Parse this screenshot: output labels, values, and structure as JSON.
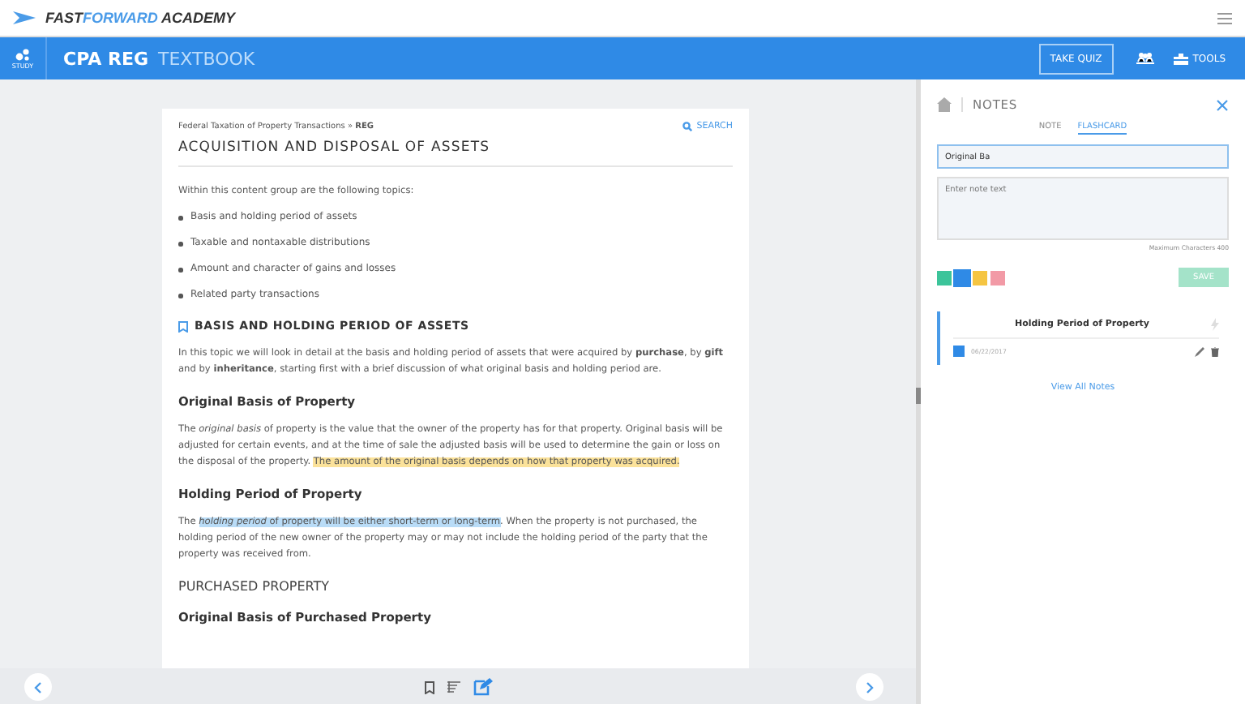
{
  "brand": {
    "name_a": "FAST",
    "name_b": "FORWARD",
    "name_c": " ACADEMY"
  },
  "topbar": {
    "study_label": "STUDY",
    "course": "CPA REG",
    "section": "TEXTBOOK",
    "take_quiz": "TAKE QUIZ",
    "tools": "TOOLS"
  },
  "article": {
    "breadcrumb": "Federal Taxation of Property Transactions » **REG**",
    "search": "SEARCH",
    "title": "ACQUISITION AND DISPOSAL OF ASSETS",
    "blocks": [
      {
        "kind": "para",
        "segments": [
          {
            "text": "Within this content group are the following topics:"
          }
        ]
      },
      {
        "kind": "bullet",
        "segments": [
          {
            "text": "Basis and holding period of assets"
          }
        ]
      },
      {
        "kind": "bullet",
        "segments": [
          {
            "text": "Taxable and nontaxable distributions"
          }
        ]
      },
      {
        "kind": "bullet",
        "segments": [
          {
            "text": "Amount and character of gains and losses"
          }
        ]
      },
      {
        "kind": "bullet",
        "segments": [
          {
            "text": "Related party transactions"
          }
        ]
      },
      {
        "kind": "section",
        "segments": [
          {
            "text": "BASIS AND HOLDING PERIOD OF ASSETS"
          }
        ]
      },
      {
        "kind": "para",
        "segments": [
          {
            "text": "In this topic we will look in detail at the basis and holding period of assets that were acquired by **purchase**, by **gift** and by **inheritance**, starting first with a brief discussion of what original basis and holding period are."
          }
        ]
      },
      {
        "kind": "heading",
        "segments": [
          {
            "text": "Original Basis of Property"
          }
        ]
      },
      {
        "kind": "para",
        "segments": [
          {
            "text": "The *original basis* of property is the value that the owner of the property has for that property. Original basis will be adjusted for certain events, and at the time of sale the adjusted basis will be used to determine the gain or loss on the disposal of the property. "
          },
          {
            "text": "The amount of the original basis depends on how that property was acquired.",
            "color": "#fbe29a"
          }
        ]
      },
      {
        "kind": "heading",
        "segments": [
          {
            "text": "Holding Period of Property"
          }
        ]
      },
      {
        "kind": "para",
        "segments": [
          {
            "text": "The "
          },
          {
            "text": "*holding period* of property will be either short-term or long-term",
            "color": "#b9dcf7"
          },
          {
            "text": ". When the property is not purchased, the holding period of the new owner of the property may or may not include the holding period of the party that the property was received from."
          }
        ]
      },
      {
        "kind": "caps",
        "segments": [
          {
            "text": "PURCHASED PROPERTY"
          }
        ]
      },
      {
        "kind": "heading",
        "segments": [
          {
            "text": "Original Basis of Purchased Property"
          }
        ]
      }
    ]
  },
  "notes": {
    "title": "NOTES",
    "tabs": [
      {
        "label": "NOTE",
        "selected": false
      },
      {
        "label": "FLASHCARD",
        "selected": true
      }
    ],
    "title_value": "Original Ba",
    "text_placeholder": "Enter note text",
    "max_chars": "Maximum Characters 400",
    "swatches": [
      {
        "color": "#3cc49a",
        "selected": false
      },
      {
        "color": "#2f8ae6",
        "selected": true
      },
      {
        "color": "#f5c542",
        "selected": false
      },
      {
        "color": "#f29aa6",
        "selected": false
      }
    ],
    "save": "SAVE",
    "cards": [
      {
        "title": "Holding Period of Property",
        "date": "06/22/2017",
        "color": "#2f8ae6"
      }
    ],
    "view_all": "View All Notes"
  }
}
